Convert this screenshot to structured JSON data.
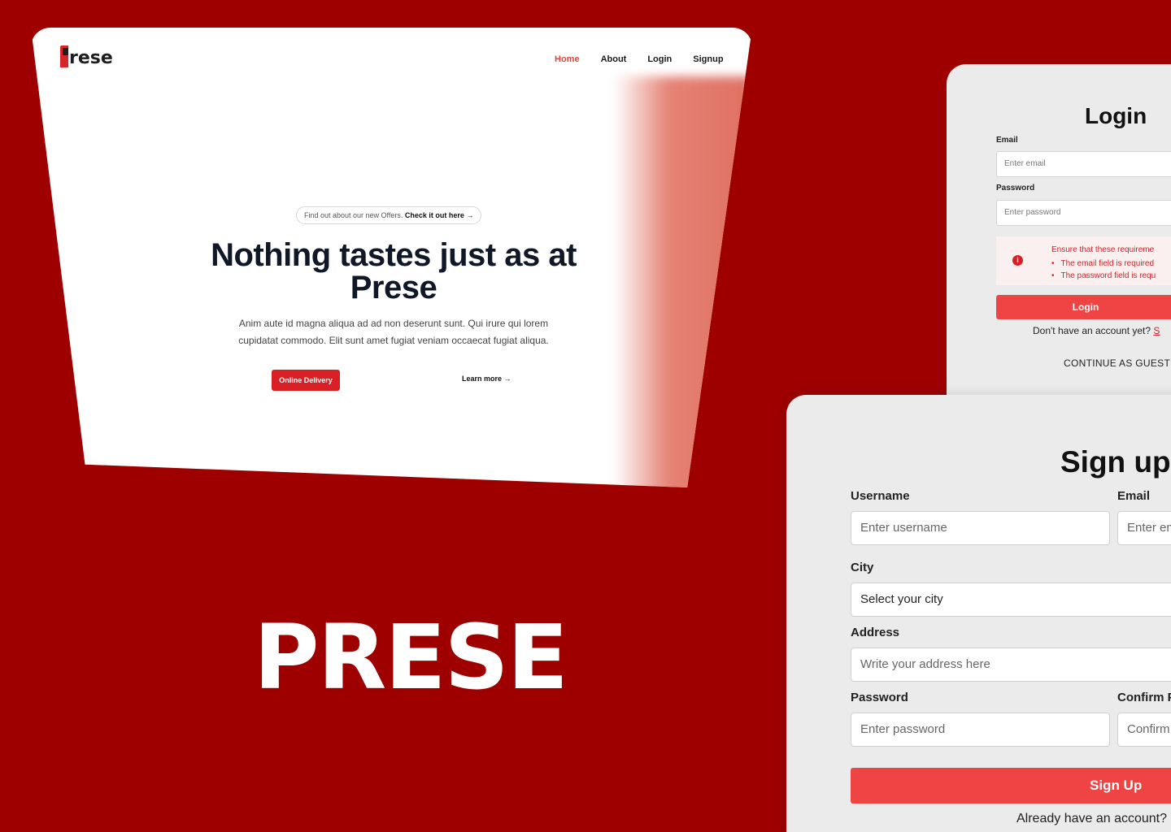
{
  "hero": {
    "logo_text": "rese",
    "nav": [
      "Home",
      "About",
      "Login",
      "Signup"
    ],
    "offer_text": "Find out about our new Offers.",
    "offer_link": "Check it out here →",
    "title": "Nothing tastes just as at Prese",
    "description": "Anim aute id magna aliqua ad ad non deserunt sunt. Qui irure qui lorem cupidatat commodo. Elit sunt amet fugiat veniam occaecat fugiat aliqua.",
    "primary_button": "Online Delivery",
    "secondary_link": "Learn more →"
  },
  "brand": "PRESE",
  "login": {
    "title": "Login",
    "email_label": "Email",
    "email_placeholder": "Enter email",
    "password_label": "Password",
    "password_placeholder": "Enter password",
    "alert_title": "Ensure that these requireme",
    "alert_items": [
      "The email field is required",
      "The password field is requ"
    ],
    "button": "Login",
    "footer_text": "Don't have an account yet?",
    "footer_link": "S",
    "guest": "CONTINUE AS GUEST"
  },
  "signup": {
    "title": "Sign up",
    "username_label": "Username",
    "username_placeholder": "Enter username",
    "email_label": "Email",
    "email_placeholder": "Enter em",
    "city_label": "City",
    "city_value": "Select your city",
    "address_label": "Address",
    "address_placeholder": "Write your address here",
    "password_label": "Password",
    "password_placeholder": "Enter password",
    "confirm_label": "Confirm P",
    "confirm_placeholder": "Confirm",
    "button": "Sign Up",
    "footer_text": "Already have an account?"
  },
  "colors": {
    "background": "#9e0000",
    "accent": "#ef4444",
    "brand_red": "#d81f26"
  }
}
